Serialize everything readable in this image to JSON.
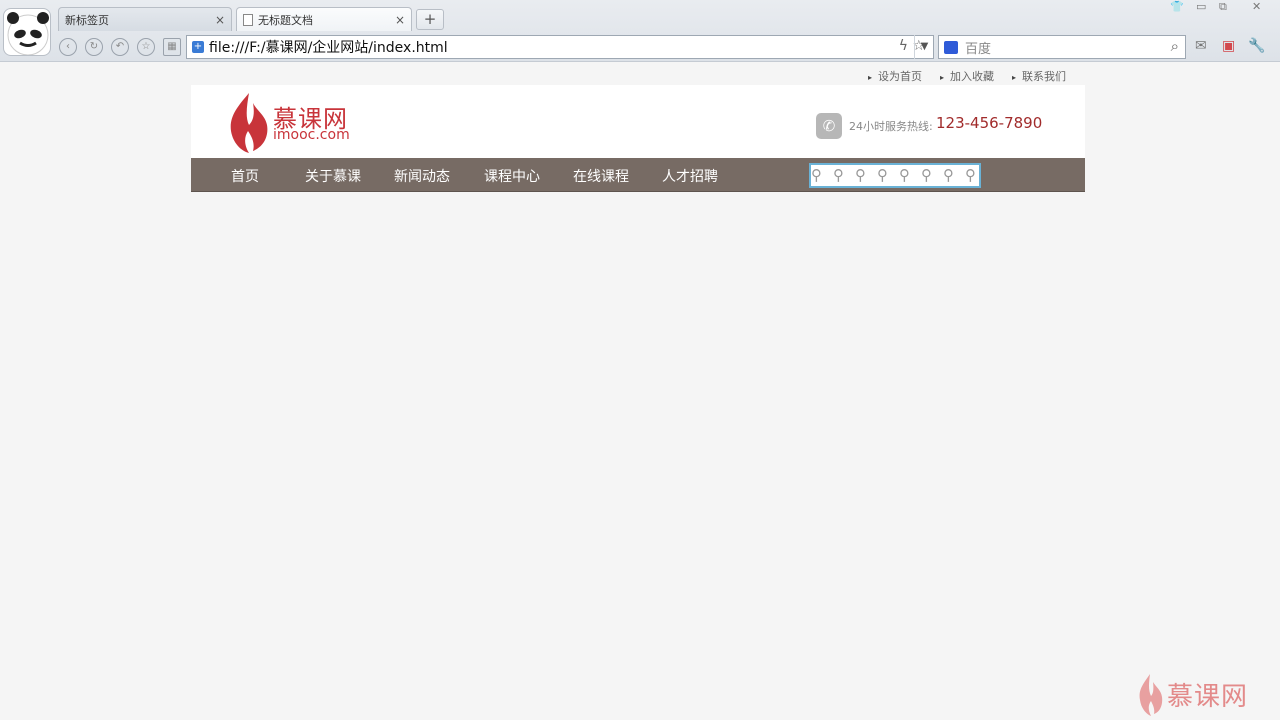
{
  "browser": {
    "tabs": [
      {
        "label": "新标签页",
        "close": "×"
      },
      {
        "label": "无标题文档",
        "close": "×"
      }
    ],
    "new_tab": "+",
    "url": "file:///F:/慕课网/企业网站/index.html",
    "search_engine_placeholder": "百度"
  },
  "site": {
    "top_links": [
      "设为首页",
      "加入收藏",
      "联系我们"
    ],
    "logo_cn": "慕课网",
    "logo_en": "imooc.com",
    "hotline_label": "24小时服务热线:",
    "hotline_number": "123-456-7890",
    "nav": [
      "首页",
      "关于慕课",
      "新闻动态",
      "课程中心",
      "在线课程",
      "人才招聘"
    ],
    "colors": {
      "nav_bg": "#776b64",
      "brand": "#c8343a",
      "search_border": "#6ab2d6"
    }
  },
  "watermark": "慕课网"
}
